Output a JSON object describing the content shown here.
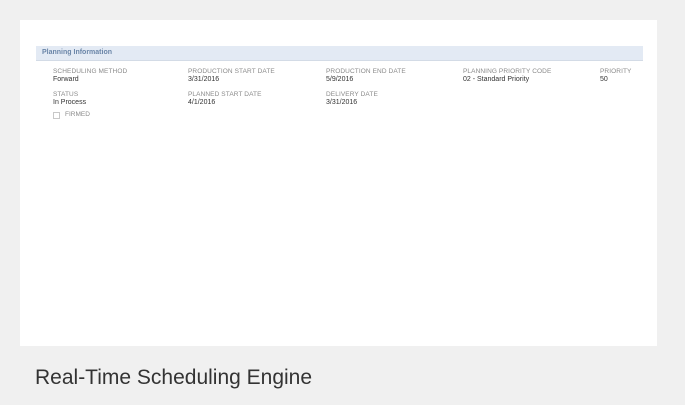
{
  "panel": {
    "title": "Planning Information",
    "fields": {
      "scheduling_method": {
        "label": "SCHEDULING METHOD",
        "value": "Forward"
      },
      "production_start_date": {
        "label": "PRODUCTION START DATE",
        "value": "3/31/2016"
      },
      "production_end_date": {
        "label": "PRODUCTION END DATE",
        "value": "5/9/2016"
      },
      "planning_priority_code": {
        "label": "PLANNING PRIORITY CODE",
        "value": "02 - Standard Priority"
      },
      "priority": {
        "label": "PRIORITY",
        "value": "50"
      },
      "status": {
        "label": "STATUS",
        "value": "In Process"
      },
      "planned_start_date": {
        "label": "PLANNED START DATE",
        "value": "4/1/2016"
      },
      "delivery_date": {
        "label": "DELIVERY DATE",
        "value": "3/31/2016"
      }
    },
    "firmed": {
      "label": "FIRMED",
      "checked": false
    }
  },
  "caption": "Real-Time Scheduling Engine"
}
